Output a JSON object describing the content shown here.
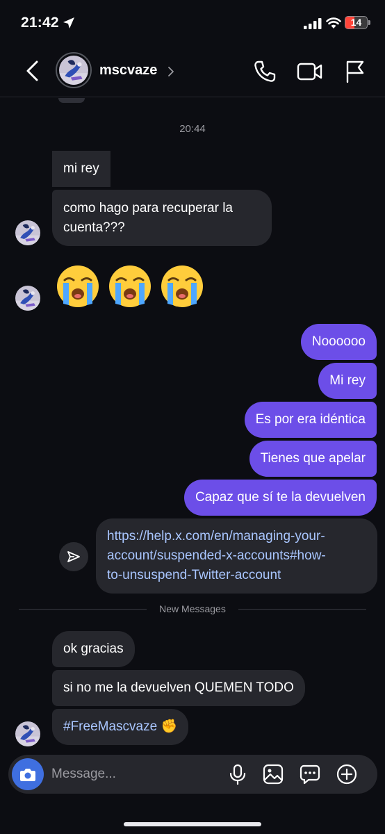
{
  "status_bar": {
    "time": "21:42",
    "battery": "14",
    "icons": [
      "location-arrow-icon",
      "signal-bars-icon",
      "wifi-icon",
      "battery-icon"
    ]
  },
  "header": {
    "username": "mscvaze",
    "icons": [
      "back-chevron-icon",
      "chevron-right-icon",
      "phone-icon",
      "video-camera-icon",
      "flag-icon"
    ]
  },
  "conversation": {
    "timestamp": "20:44",
    "incoming_1": [
      "mi rey",
      "como hago para recuperar la cuenta???"
    ],
    "emojis": [
      "😭",
      "😭",
      "😭"
    ],
    "outgoing": [
      "Noooooo",
      "Mi rey",
      "Es por era idéntica",
      "Tienes que apelar",
      "Capaz que sí te la devuelven"
    ],
    "shared_link": "https://help.x.com/en/managing-your-account/suspended-x-accounts#how-to-unsuspend-Twitter-account",
    "link_lines": [
      "https://help.x.com/en/managing-your-",
      "account/suspended-x-accounts#how-",
      "to-unsuspend-Twitter-account"
    ],
    "new_messages_label": "New Messages",
    "incoming_2": [
      "ok gracias",
      "si no me la devuelven QUEMEN TODO",
      "#FreeMascvaze ✊"
    ]
  },
  "composer": {
    "placeholder": "Message...",
    "icons": [
      "camera-icon",
      "microphone-icon",
      "gallery-icon",
      "sticker-chat-icon",
      "plus-icon"
    ]
  },
  "colors": {
    "background": "#0c0d12",
    "incoming_bubble": "#26272d",
    "outgoing_bubble": "#6c4ee8",
    "link_text": "#a9c6ff",
    "camera_button": "#3f6fe0"
  }
}
